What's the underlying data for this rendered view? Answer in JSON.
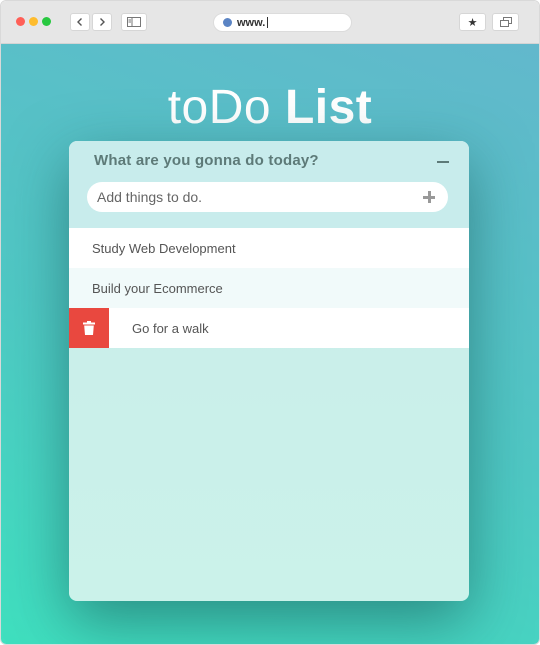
{
  "browser": {
    "url": "www.",
    "star_icon": "★"
  },
  "app": {
    "title_light": "toDo",
    "title_bold": "List",
    "question": "What are you gonna do today?",
    "input_placeholder": "Add things to do.",
    "todos": [
      {
        "label": "Study Web Development"
      },
      {
        "label": "Build your Ecommerce"
      },
      {
        "label": "Go for a walk"
      }
    ]
  },
  "colors": {
    "delete": "#e9483f",
    "gradient_start": "#3fe0bf",
    "gradient_end": "#62b8cc"
  }
}
